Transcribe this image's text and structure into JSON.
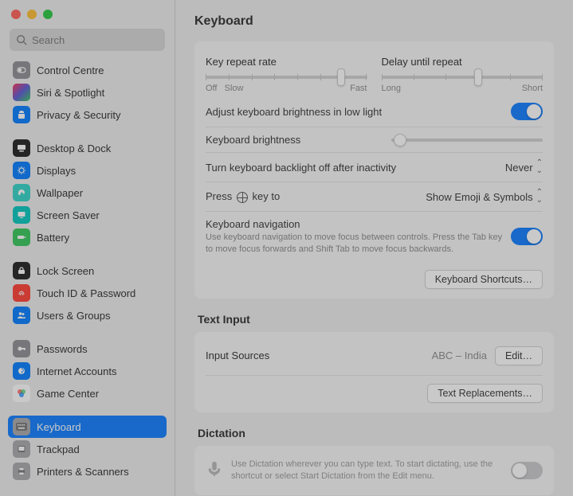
{
  "search": {
    "placeholder": "Search"
  },
  "sidebar": {
    "items": [
      {
        "label": "Control Centre"
      },
      {
        "label": "Siri & Spotlight"
      },
      {
        "label": "Privacy & Security"
      },
      {
        "label": "Desktop & Dock"
      },
      {
        "label": "Displays"
      },
      {
        "label": "Wallpaper"
      },
      {
        "label": "Screen Saver"
      },
      {
        "label": "Battery"
      },
      {
        "label": "Lock Screen"
      },
      {
        "label": "Touch ID & Password"
      },
      {
        "label": "Users & Groups"
      },
      {
        "label": "Passwords"
      },
      {
        "label": "Internet Accounts"
      },
      {
        "label": "Game Center"
      },
      {
        "label": "Keyboard"
      },
      {
        "label": "Trackpad"
      },
      {
        "label": "Printers & Scanners"
      }
    ]
  },
  "page": {
    "title": "Keyboard",
    "repeat": {
      "rate_label": "Key repeat rate",
      "delay_label": "Delay until repeat",
      "rate_min": "Off",
      "rate_min2": "Slow",
      "rate_max": "Fast",
      "delay_min": "Long",
      "delay_max": "Short"
    },
    "brightness_auto": "Adjust keyboard brightness in low light",
    "brightness": "Keyboard brightness",
    "backlight_off": "Turn keyboard backlight off after inactivity",
    "backlight_value": "Never",
    "press_globe_pre": "Press",
    "press_globe_post": "key to",
    "press_globe_value": "Show Emoji & Symbols",
    "nav_title": "Keyboard navigation",
    "nav_desc": "Use keyboard navigation to move focus between controls. Press the Tab key to move focus forwards and Shift Tab to move focus backwards.",
    "shortcuts_btn": "Keyboard Shortcuts…",
    "text_input": "Text Input",
    "input_sources": "Input Sources",
    "input_sources_value": "ABC – India",
    "edit_btn": "Edit…",
    "text_repl_btn": "Text Replacements…",
    "dictation": "Dictation",
    "dictation_desc": "Use Dictation wherever you can type text. To start dictating, use the shortcut or select Start Dictation from the Edit menu."
  }
}
